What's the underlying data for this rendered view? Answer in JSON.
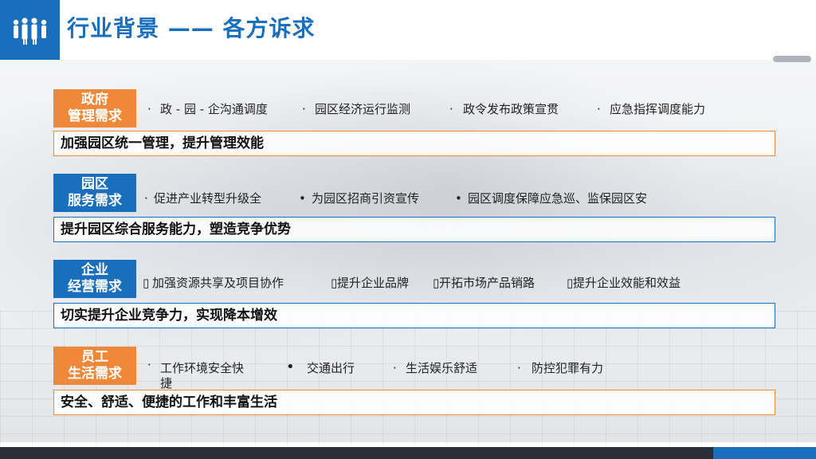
{
  "header": {
    "title": "行业背景 —— 各方诉求",
    "icon": "people-group-icon"
  },
  "sections": [
    {
      "tag_line1": "政府",
      "tag_line2": "管理需求",
      "tag_color": "#f0883a",
      "points": [
        "政 - 园 - 企沟通调度",
        "园区经济运行监测",
        "政令发布政策宣贯",
        "应急指挥调度能力"
      ],
      "summary": "加强园区统一管理，提升管理效能"
    },
    {
      "tag_line1": "园区",
      "tag_line2": "服务需求",
      "tag_color": "#1a6fbd",
      "points": [
        "促进产业转型升级全",
        "为园区招商引资宣传",
        "园区调度保障应急巡、监保园区安"
      ],
      "summary": "提升园区综合服务能力，塑造竞争优势"
    },
    {
      "tag_line1": "企业",
      "tag_line2": "经营需求",
      "tag_color": "#1a6fbd",
      "points": [
        "加强资源共享及项目协作",
        "提升企业品牌",
        "开拓市场产品销路",
        "提升企业效能和效益"
      ],
      "summary": "切实提升企业竞争力，实现降本增效"
    },
    {
      "tag_line1": "员工",
      "tag_line2": "生活需求",
      "tag_color": "#f0883a",
      "points": [
        "工作环境安全快捷",
        "交通出行",
        "生活娱乐舒适",
        "防控犯罪有力"
      ],
      "summary": "安全、舒适、便捷的工作和丰富生活"
    }
  ]
}
